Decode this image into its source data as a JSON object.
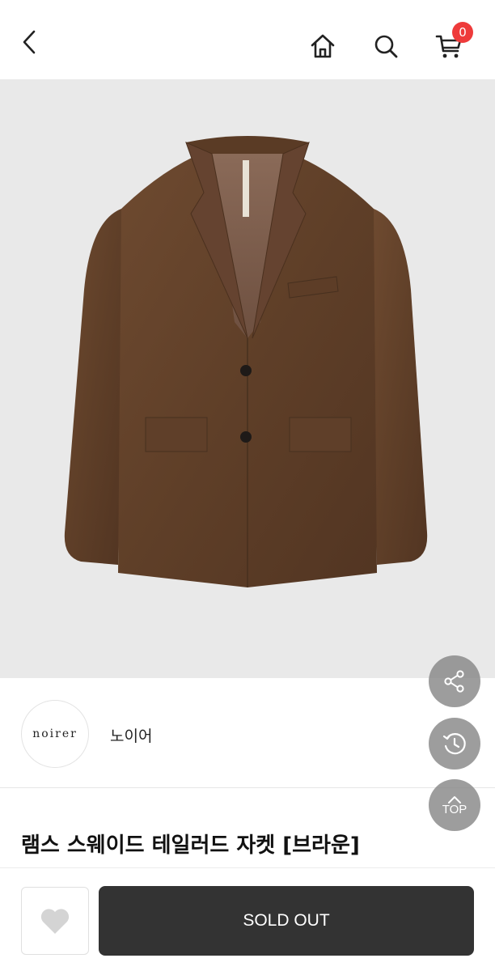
{
  "header": {
    "back_icon": "chevron-left-icon",
    "home_icon": "home-icon",
    "search_icon": "search-icon",
    "cart_icon": "cart-icon",
    "cart_count": "0"
  },
  "product": {
    "image": "brown suede tailored jacket",
    "brand_logo_text": "noirer",
    "brand_name": "노이어",
    "title": "램스 스웨이드 테일러드 자켓 [브라운]"
  },
  "floating_buttons": {
    "share_icon": "share-icon",
    "recent_icon": "history-icon",
    "top_label": "TOP"
  },
  "bottom_bar": {
    "wish_icon": "heart-icon",
    "soldout_label": "SOLD OUT"
  },
  "colors": {
    "badge": "#ee3b3b",
    "button": "#333333",
    "hero_bg": "#e9e9e9"
  }
}
